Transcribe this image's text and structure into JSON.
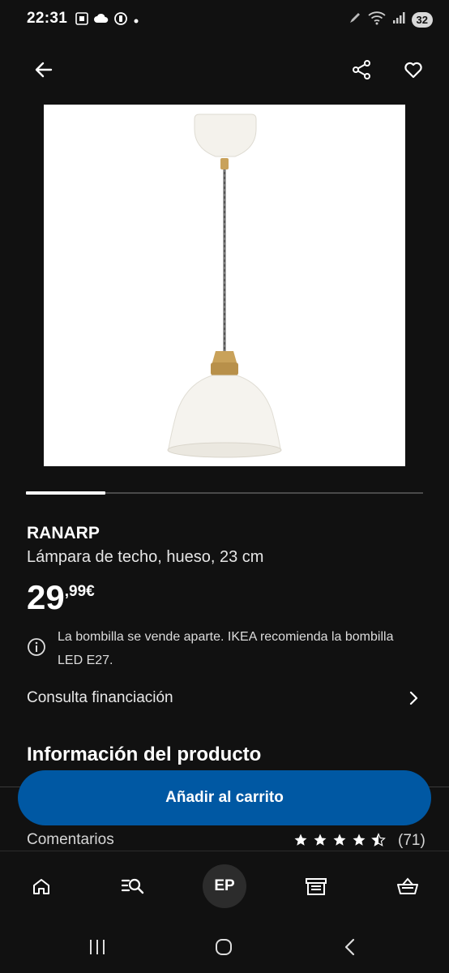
{
  "status_bar": {
    "time": "22:31",
    "battery": "32",
    "icons_left": [
      "screenshot-icon",
      "cloud-icon",
      "alarm-icon",
      "dot-icon"
    ],
    "icons_right": [
      "pen-icon",
      "wifi-icon",
      "signal-icon"
    ]
  },
  "top_bar": {
    "back_icon": "arrow-left-icon",
    "share_icon": "share-icon",
    "favorite_icon": "heart-icon"
  },
  "gallery": {
    "image": "pendant-lamp-image",
    "active_index": 1,
    "progress_fraction": 0.2
  },
  "product": {
    "name": "RANARP",
    "description": "Lámpara de techo, hueso, 23 cm",
    "price_integer": "29",
    "price_decimal": ",99€",
    "note": "La bombilla se vende aparte. IKEA recomienda la bombilla LED E27.",
    "financing_label": "Consulta financiación",
    "section_title": "Información del producto"
  },
  "actions": {
    "add_to_cart": "Añadir al carrito"
  },
  "reviews": {
    "label": "Comentarios",
    "rating": 4.5,
    "count": "(71)"
  },
  "bottom_nav": {
    "items": [
      "home-icon",
      "search-list-icon",
      "profile",
      "store-icon",
      "basket-icon"
    ],
    "avatar_initials": "EP"
  },
  "system_nav": [
    "recents-icon",
    "home-circle-icon",
    "back-chevron-icon"
  ],
  "colors": {
    "background": "#111111",
    "accent": "#0058a3",
    "text": "#ffffff"
  }
}
